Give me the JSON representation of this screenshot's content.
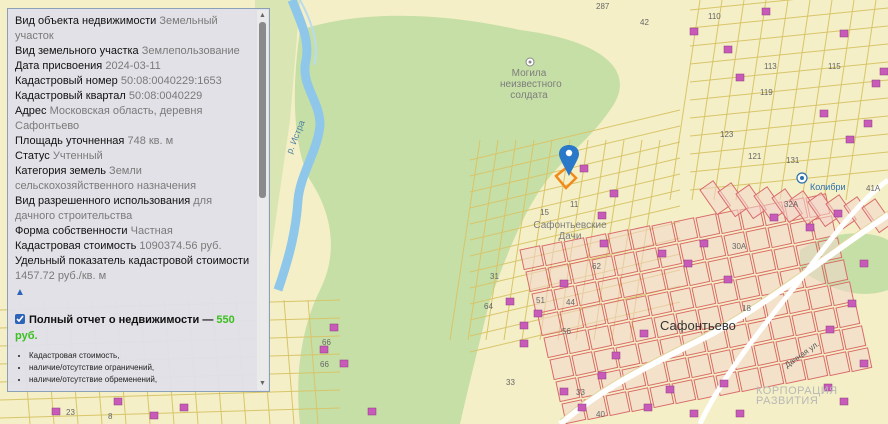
{
  "info_panel": {
    "fields": [
      {
        "key": "Вид объекта недвижимости",
        "value": "Земельный участок"
      },
      {
        "key": "Вид земельного участка",
        "value": "Землепользование"
      },
      {
        "key": "Дата присвоения",
        "value": "2024-03-11"
      },
      {
        "key": "Кадастровый номер",
        "value": "50:08:0040229:1653"
      },
      {
        "key": "Кадастровый квартал",
        "value": "50:08:0040229"
      },
      {
        "key": "Адрес",
        "value": "Московская область, деревня Сафонтьево"
      },
      {
        "key": "Площадь уточненная",
        "value": "748 кв. м"
      },
      {
        "key": "Статус",
        "value": "Учтенный"
      },
      {
        "key": "Категория земель",
        "value": "Земли сельскохозяйственного назначения"
      },
      {
        "key": "Вид разрешенного использования",
        "value": "для дачного строительства"
      },
      {
        "key": "Форма собственности",
        "value": "Частная"
      },
      {
        "key": "Кадастровая стоимость",
        "value": "1090374.56 руб."
      },
      {
        "key": "Удельный показатель кадастровой стоимости",
        "value": "1457.72 руб./кв. м"
      }
    ],
    "collapse_arrow": "▲",
    "report": {
      "title": "Полный отчет о недвижимости — ",
      "price": "550 руб.",
      "checked": true,
      "items": [
        "Кадастровая стоимость,",
        "наличие/отсутствие ограничений,",
        "наличие/отсутствие обременений,"
      ]
    },
    "scroll_up": "▲",
    "scroll_down": "▼"
  },
  "map": {
    "labels": {
      "grave": "Могила неизвестного солдата",
      "dachi": "Сафонтьевские Дачи",
      "village": "Сафонтьево",
      "river": "р. Истра",
      "kolibri": "Колибри",
      "street": "Дачная ул.",
      "watermark_line1": "КОРПОРАЦИЯ",
      "watermark_line2": "РАЗВИТИЯ"
    },
    "numbers": [
      "287",
      "42",
      "110",
      "113",
      "119",
      "115",
      "123",
      "121",
      "131",
      "32А",
      "41А",
      "30А",
      "11",
      "15",
      "31",
      "51",
      "44",
      "64",
      "62",
      "56",
      "18",
      "33",
      "33",
      "66",
      "66",
      "23",
      "8",
      "40"
    ],
    "colors": {
      "forest": "#c6dfa6",
      "field": "#f4efc6",
      "river": "#8fc7ea",
      "parcel_line": "#d8c56a",
      "red_parcel": "#d96b6b",
      "building": "#c85ab8",
      "selected": "#f28a1a",
      "marker": "#2a78c8"
    }
  }
}
